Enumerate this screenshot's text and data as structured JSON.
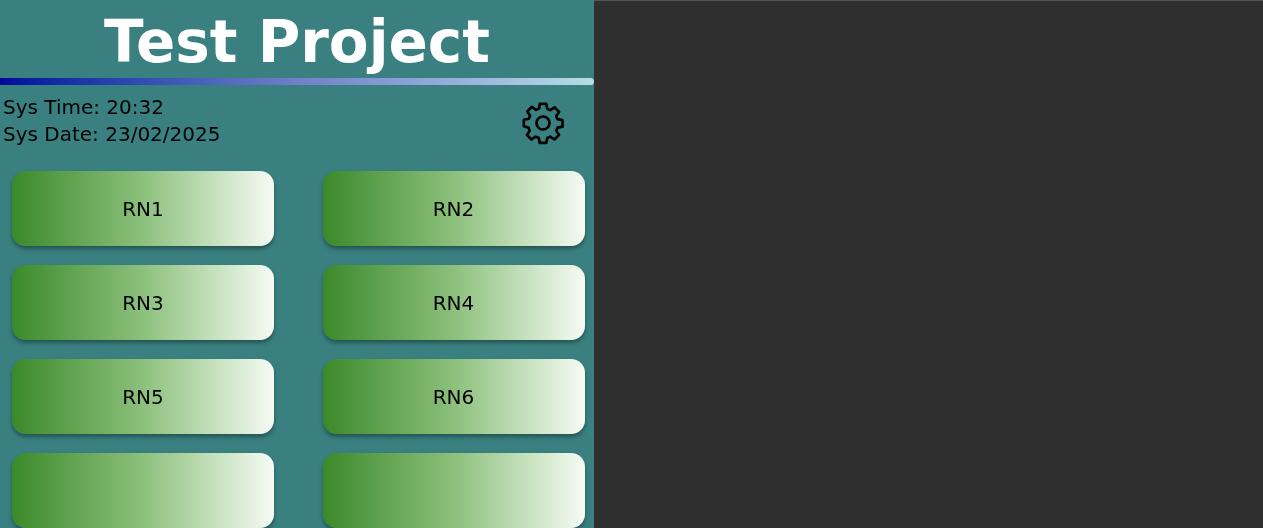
{
  "title": "Test Project",
  "status": {
    "time": "Sys Time: 20:32",
    "date": "Sys Date: 23/02/2025"
  },
  "buttons": [
    {
      "kind": "full",
      "label": "RN1"
    },
    {
      "kind": "full",
      "label": "RN2"
    },
    {
      "kind": "full",
      "label": "RN3"
    },
    {
      "kind": "full",
      "label": "RN4"
    },
    {
      "kind": "full",
      "label": "RN5"
    },
    {
      "kind": "full",
      "label": "RN6"
    },
    {
      "kind": "cut"
    },
    {
      "kind": "cut"
    }
  ]
}
